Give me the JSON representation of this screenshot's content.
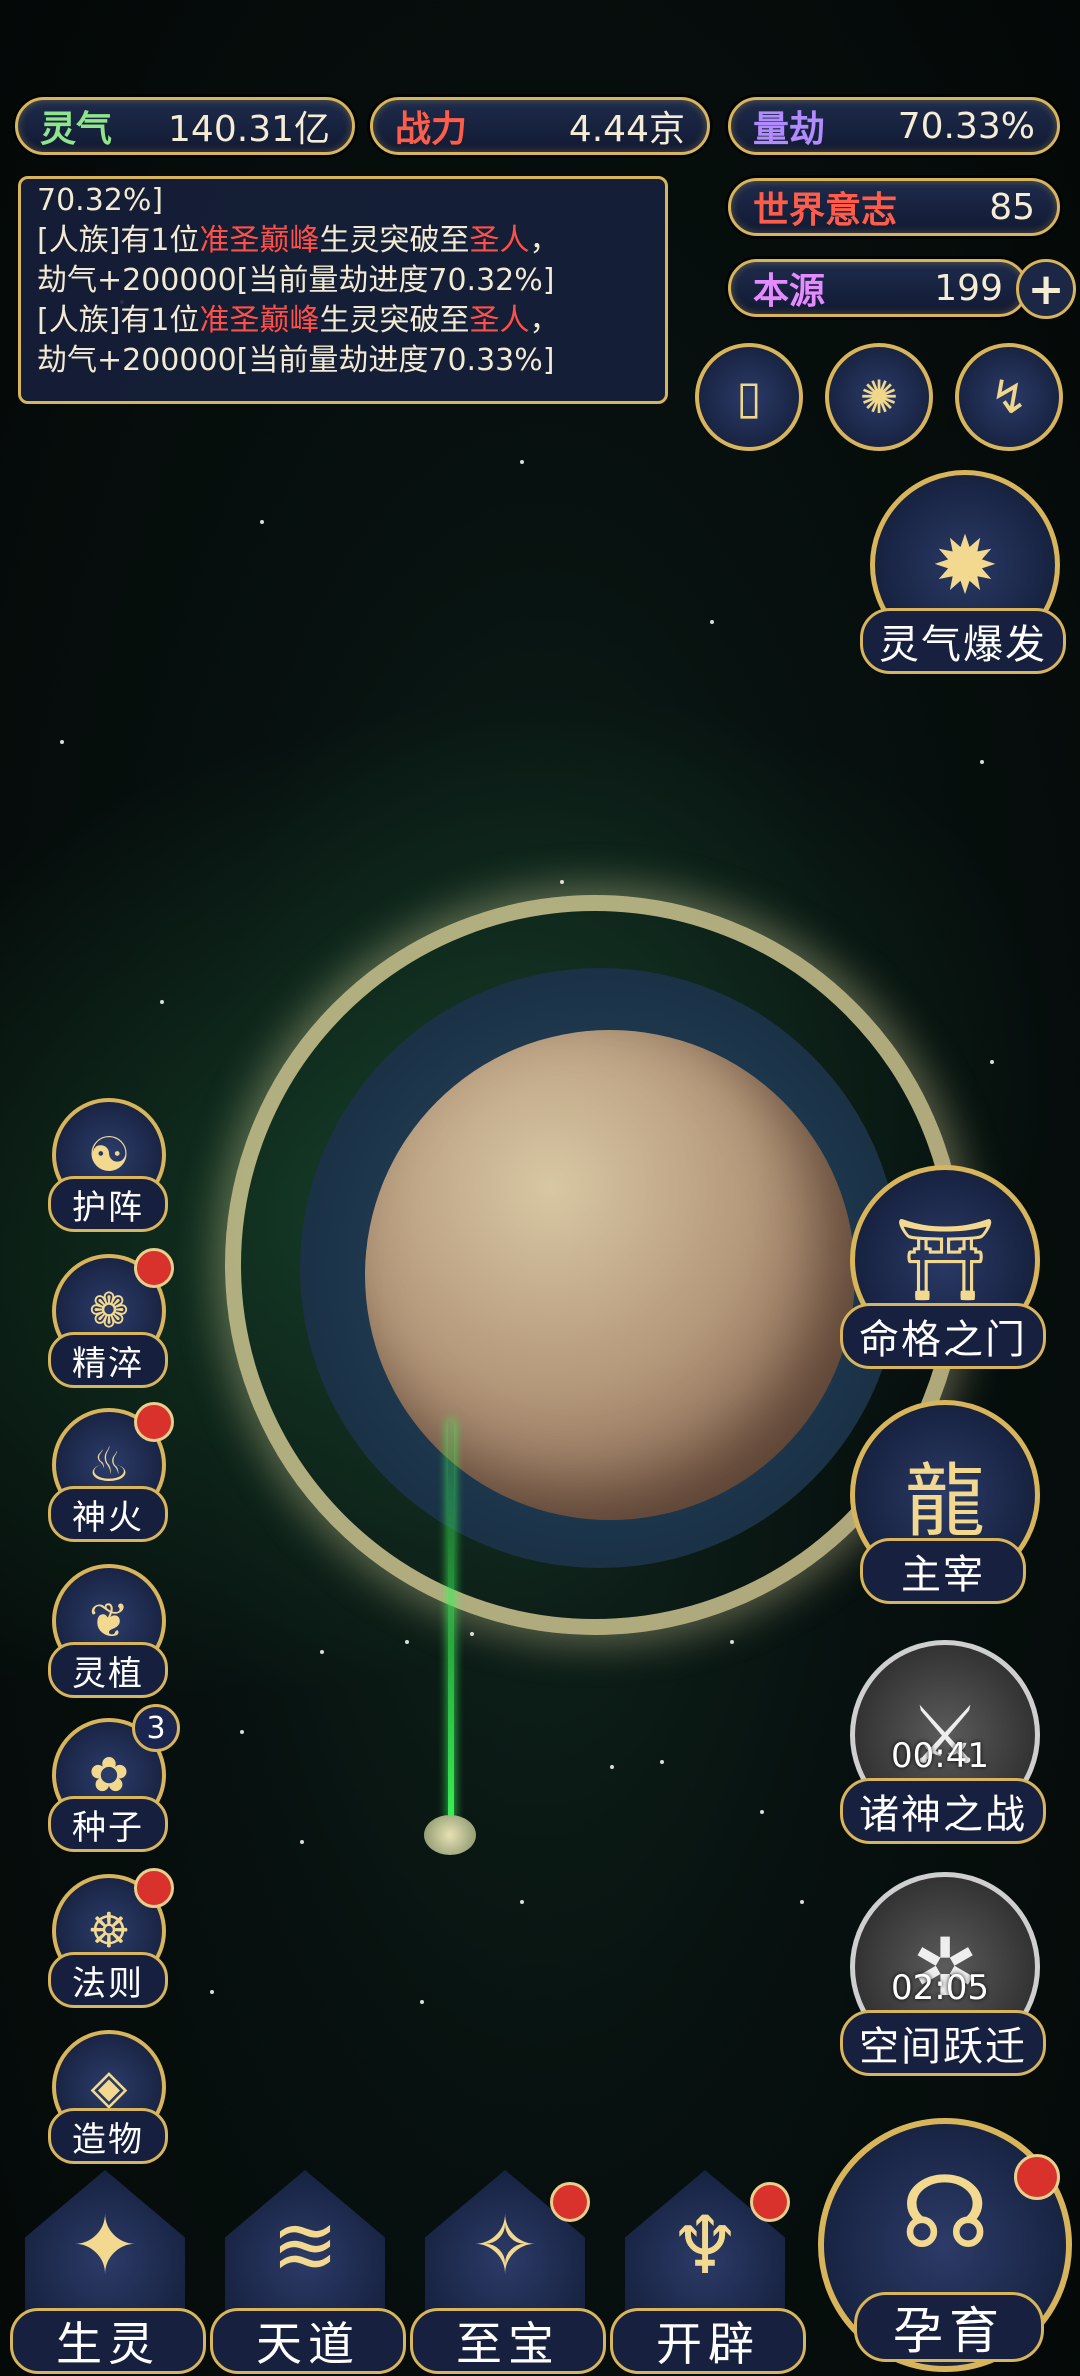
{
  "stats": {
    "lingqi": {
      "label": "灵气",
      "value": "140.31亿"
    },
    "zhanli": {
      "label": "战力",
      "value": "4.44京"
    },
    "liangjie": {
      "label": "量劫",
      "value": "70.33%"
    },
    "shijie": {
      "label": "世界意志",
      "value": "85"
    },
    "benyuan": {
      "label": "本源",
      "value": "199",
      "plus": "+"
    }
  },
  "log": {
    "line0": "70.32%]",
    "entry1": {
      "prefix": "[人族]有1位",
      "rank": "准圣巅峰",
      "mid": "生灵突破至",
      "target": "圣人",
      "suffix": "，",
      "line2": "劫气+200000[当前量劫进度70.32%]"
    },
    "entry2": {
      "prefix": "[人族]有1位",
      "rank": "准圣巅峰",
      "mid": "生灵突破至",
      "target": "圣人",
      "suffix": "，",
      "line2": "劫气+200000[当前量劫进度70.33%]"
    }
  },
  "top_icons": [
    "cards-icon",
    "portal-swirl-icon",
    "scroll-icon"
  ],
  "lingqi_baofa": {
    "label": "灵气爆发"
  },
  "left_menu": [
    {
      "label": "护阵",
      "icon": "yin-yang-icon",
      "dot": false
    },
    {
      "label": "精淬",
      "icon": "lotus-flame-icon",
      "dot": true
    },
    {
      "label": "神火",
      "icon": "fire-icon",
      "dot": true
    },
    {
      "label": "灵植",
      "icon": "plant-icon",
      "dot": false
    },
    {
      "label": "种子",
      "icon": "seed-icon",
      "dot": false,
      "badge": "3"
    },
    {
      "label": "法则",
      "icon": "rune-beast-icon",
      "dot": true
    },
    {
      "label": "造物",
      "icon": "diamond-icon",
      "dot": false
    }
  ],
  "right_menu": {
    "mingge": {
      "label": "命格之门"
    },
    "zhuzai": {
      "label": "主宰"
    },
    "zhushen": {
      "label": "诸神之战",
      "timer": "00:41"
    },
    "kongjian": {
      "label": "空间跃迁",
      "timer": "02:05"
    }
  },
  "bottom_nav": [
    {
      "label": "生灵",
      "dot": false
    },
    {
      "label": "天道",
      "dot": false
    },
    {
      "label": "至宝",
      "dot": true
    },
    {
      "label": "开辟",
      "dot": true
    }
  ],
  "main_button": {
    "label": "孕育",
    "dot": true
  },
  "colors": {
    "gold": "#d8b45a",
    "red": "#ff4f47",
    "panel": "#16203e"
  }
}
